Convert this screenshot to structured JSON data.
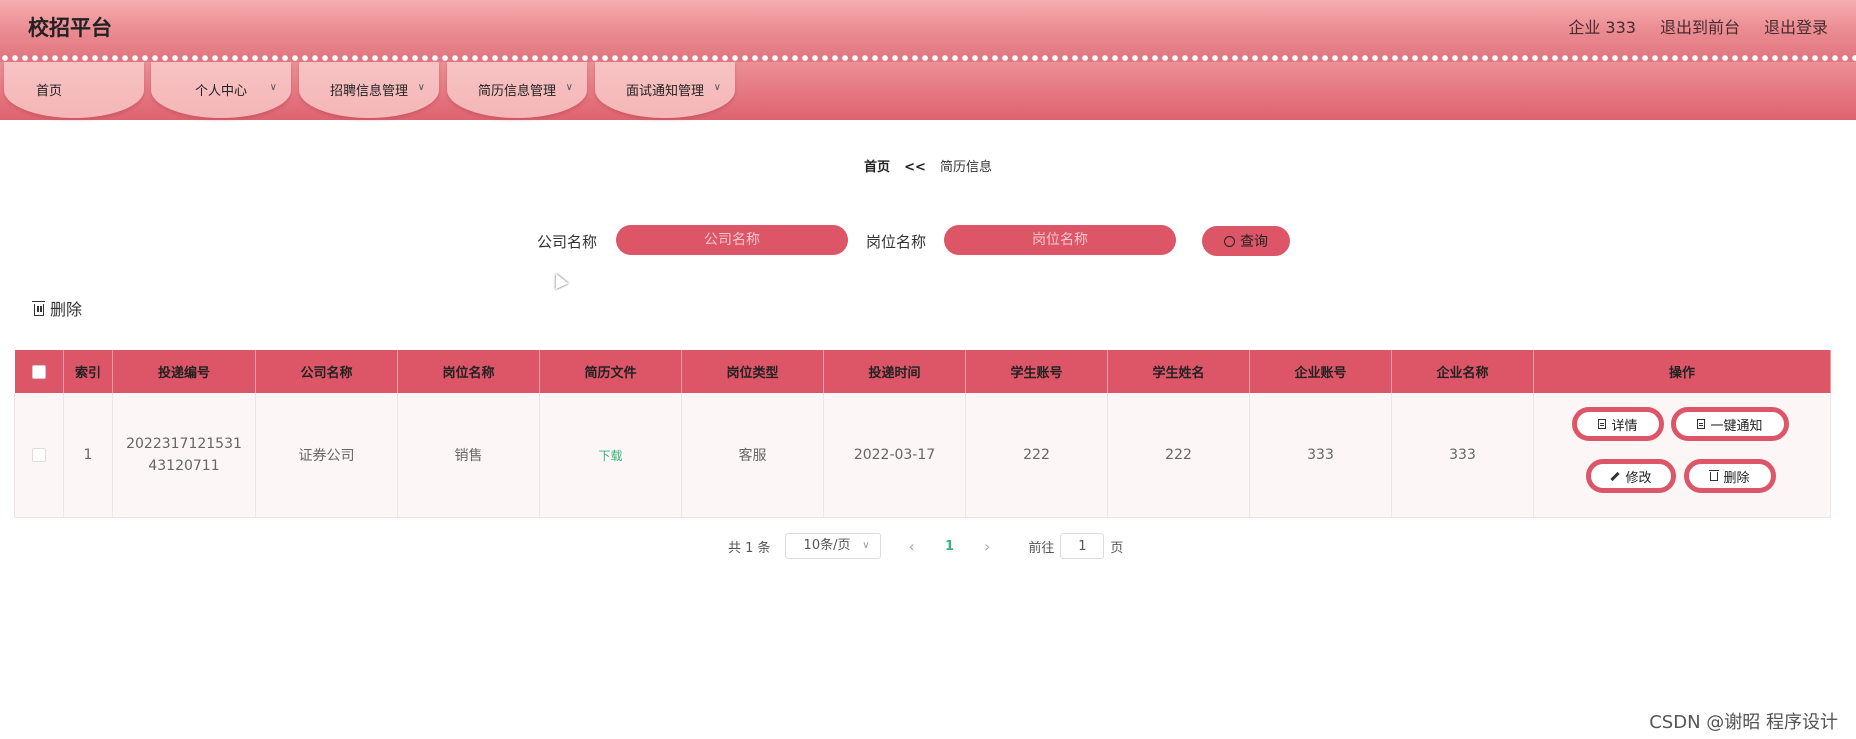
{
  "header": {
    "brand": "校招平台",
    "user": "企业 333",
    "to_front": "退出到前台",
    "logout": "退出登录"
  },
  "nav": [
    {
      "label": "首页",
      "has_dropdown": false
    },
    {
      "label": "个人中心",
      "has_dropdown": true
    },
    {
      "label": "招聘信息管理",
      "has_dropdown": true
    },
    {
      "label": "简历信息管理",
      "has_dropdown": true
    },
    {
      "label": "面试通知管理",
      "has_dropdown": true
    }
  ],
  "breadcrumb": {
    "home": "首页",
    "separator": "<<",
    "current": "简历信息"
  },
  "search": {
    "company_label": "公司名称",
    "company_placeholder": "公司名称",
    "position_label": "岗位名称",
    "position_placeholder": "岗位名称",
    "query_button": "查询"
  },
  "toolbar": {
    "delete_label": "删除"
  },
  "table": {
    "columns": [
      "索引",
      "投递编号",
      "公司名称",
      "岗位名称",
      "简历文件",
      "岗位类型",
      "投递时间",
      "学生账号",
      "学生姓名",
      "企业账号",
      "企业名称",
      "操作"
    ],
    "rows": [
      {
        "index": "1",
        "delivery_no": "202231712153143120711",
        "company": "证券公司",
        "position": "销售",
        "resume_file": "下载",
        "position_type": "客服",
        "delivery_time": "2022-03-17",
        "student_account": "222",
        "student_name": "222",
        "enterprise_account": "333",
        "enterprise_name": "333",
        "actions": {
          "detail": "详情",
          "notify": "一键通知",
          "edit": "修改",
          "delete": "删除"
        }
      }
    ]
  },
  "pagination": {
    "total": "共 1 条",
    "page_size": "10条/页",
    "current_page": "1",
    "goto_label": "前往",
    "goto_value": "1",
    "goto_suffix": "页"
  },
  "watermark": "CSDN @谢昭  程序设计",
  "colors": {
    "accent": "#dc5668",
    "header_top": "#f6aeb1",
    "nav_tab": "#f7c3c3",
    "link_green": "#36b37e"
  }
}
